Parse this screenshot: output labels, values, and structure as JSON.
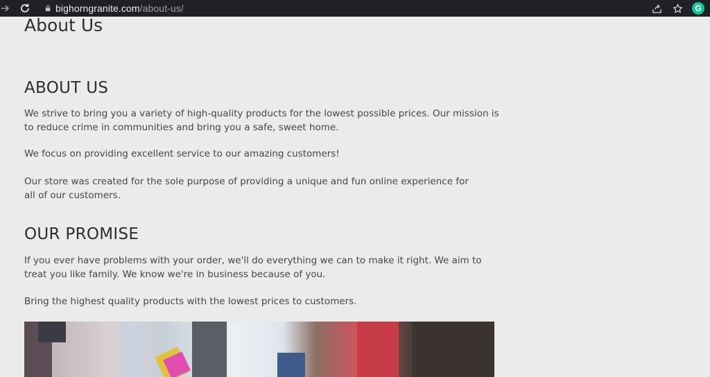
{
  "browser": {
    "url_host": "bighorngranite.com",
    "url_path": "/about-us/",
    "extension_letter": "G"
  },
  "page": {
    "title": "About Us",
    "sections": [
      {
        "heading": "ABOUT US",
        "paragraphs": [
          "We strive to bring you a variety of high-quality products for the lowest possible prices. Our mission is to reduce crime in communities and bring you a safe, sweet home.",
          "We focus on providing excellent service to our amazing customers!",
          "Our store was created for the sole purpose of providing a unique and fun online experience for all of our customers."
        ]
      },
      {
        "heading": "OUR PROMISE",
        "paragraphs": [
          "If you ever have problems with your order, we'll do everything we can to make it right. We aim to treat you like family. We know we're in business because of you.",
          "Bring the highest quality products with the lowest prices to customers."
        ]
      }
    ]
  },
  "colors": {
    "page_background": "#ebebeb",
    "browser_bar": "#202124",
    "extension_green": "#15c39a"
  }
}
